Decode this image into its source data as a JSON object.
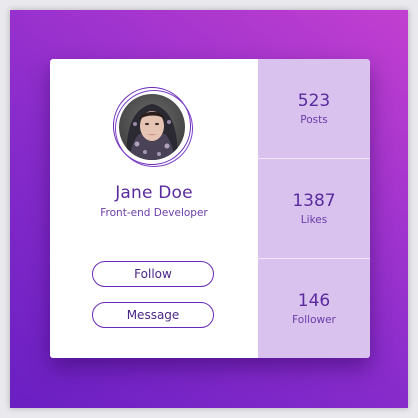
{
  "profile": {
    "name": "Jane Doe",
    "role": "Front-end Developer",
    "follow_label": "Follow",
    "message_label": "Message"
  },
  "stats": [
    {
      "value": "523",
      "label": "Posts"
    },
    {
      "value": "1387",
      "label": "Likes"
    },
    {
      "value": "146",
      "label": "Follower"
    }
  ],
  "colors": {
    "accent": "#6b2ab8",
    "text_primary": "#5a2a9e",
    "stats_bg": "#d9c2ee",
    "gradient_start": "#6a1fc2",
    "gradient_end": "#c23fd0"
  }
}
